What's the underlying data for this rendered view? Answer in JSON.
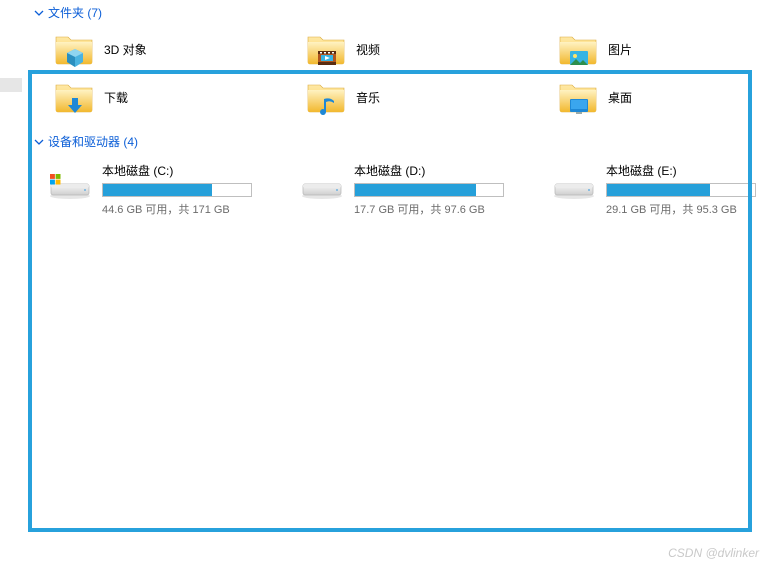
{
  "sections": {
    "folders": {
      "label": "文件夹 (7)",
      "items": [
        {
          "label": "3D 对象",
          "icon": "3dobjects"
        },
        {
          "label": "视频",
          "icon": "videos"
        },
        {
          "label": "图片",
          "icon": "pictures"
        },
        {
          "label": "下载",
          "icon": "downloads"
        },
        {
          "label": "音乐",
          "icon": "music"
        },
        {
          "label": "桌面",
          "icon": "desktop"
        }
      ]
    },
    "drives": {
      "label": "设备和驱动器 (4)",
      "items": [
        {
          "name": "本地磁盘 (C:)",
          "free": 44.6,
          "total": 171,
          "sub": "44.6 GB 可用，共 171 GB",
          "system": true
        },
        {
          "name": "本地磁盘 (D:)",
          "free": 17.7,
          "total": 97.6,
          "sub": "17.7 GB 可用，共 97.6 GB",
          "system": false
        },
        {
          "name": "本地磁盘 (E:)",
          "free": 29.1,
          "total": 95.3,
          "sub": "29.1 GB 可用，共 95.3 GB",
          "system": false
        }
      ]
    }
  },
  "watermark": "CSDN @dvlinker"
}
